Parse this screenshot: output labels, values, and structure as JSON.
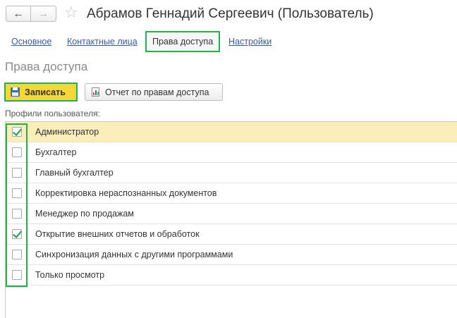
{
  "header": {
    "back_icon": "arrow-left-icon",
    "forward_icon": "arrow-right-icon",
    "favorite_icon": "star-icon",
    "title": "Абрамов Геннадий Сергеевич (Пользователь)"
  },
  "tabs": [
    {
      "label": "Основное",
      "active": false
    },
    {
      "label": "Контактные лица",
      "active": false
    },
    {
      "label": "Права доступа",
      "active": true
    },
    {
      "label": "Настройки",
      "active": false
    }
  ],
  "section": {
    "title": "Права доступа"
  },
  "toolbar": {
    "save_label": "Записать",
    "save_icon": "floppy-disk-icon",
    "report_label": "Отчет по правам доступа",
    "report_icon": "report-chart-icon"
  },
  "profiles": {
    "label": "Профили пользователя:",
    "items": [
      {
        "label": "Администратор",
        "checked": true,
        "selected": true
      },
      {
        "label": "Бухгалтер",
        "checked": false,
        "selected": false
      },
      {
        "label": "Главный бухгалтер",
        "checked": false,
        "selected": false
      },
      {
        "label": "Корректировка нераспознанных документов",
        "checked": false,
        "selected": false
      },
      {
        "label": "Менеджер по продажам",
        "checked": false,
        "selected": false
      },
      {
        "label": "Открытие внешних отчетов и обработок",
        "checked": true,
        "selected": false
      },
      {
        "label": "Синхронизация данных с другими программами",
        "checked": false,
        "selected": false
      },
      {
        "label": "Только просмотр",
        "checked": false,
        "selected": false
      }
    ]
  },
  "colors": {
    "highlight_border": "#22b24c",
    "save_button_bg": "#f5d834",
    "selected_row_bg": "#fbeebb",
    "link": "#3b5c9a",
    "checkmark": "#1f9e47"
  }
}
